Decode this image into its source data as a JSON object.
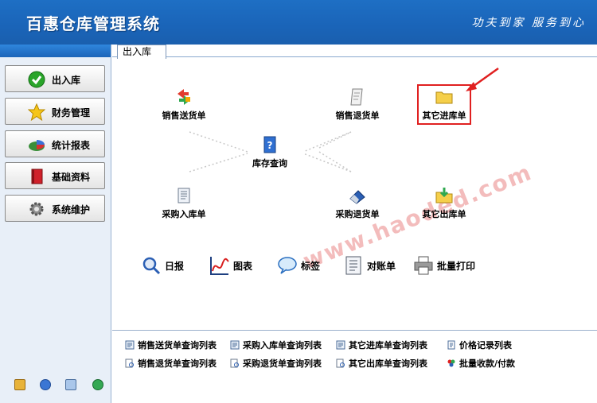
{
  "header": {
    "title": "百惠仓库管理系统",
    "slogan": "功夫到家 服务到心"
  },
  "sidebar": {
    "items": [
      {
        "label": "出入库",
        "icon": "check-circle-icon"
      },
      {
        "label": "财务管理",
        "icon": "star-icon"
      },
      {
        "label": "统计报表",
        "icon": "pie-chart-icon"
      },
      {
        "label": "基础资料",
        "icon": "book-icon"
      },
      {
        "label": "系统维护",
        "icon": "gear-icon"
      }
    ]
  },
  "tab": {
    "label": "出入库"
  },
  "flow": {
    "sales_out": "销售送货单",
    "sales_return": "销售退货单",
    "other_in": "其它进库单",
    "stock_query": "库存查询",
    "purchase_in": "采购入库单",
    "purchase_return": "采购退货单",
    "other_out": "其它出库单"
  },
  "tools": {
    "daily": "日报",
    "chart": "图表",
    "label": "标签",
    "statement": "对账单",
    "batch_print": "批量打印"
  },
  "links": {
    "row1": [
      "销售送货单查询列表",
      "采购入库单查询列表",
      "其它进库单查询列表",
      "价格记录列表"
    ],
    "row2": [
      "销售退货单查询列表",
      "采购退货单查询列表",
      "其它出库单查询列表",
      "批量收款/付款"
    ]
  },
  "watermark": "www.haoded.com",
  "colors": {
    "header_blue": "#1a64b8",
    "highlight_red": "#e02020"
  }
}
